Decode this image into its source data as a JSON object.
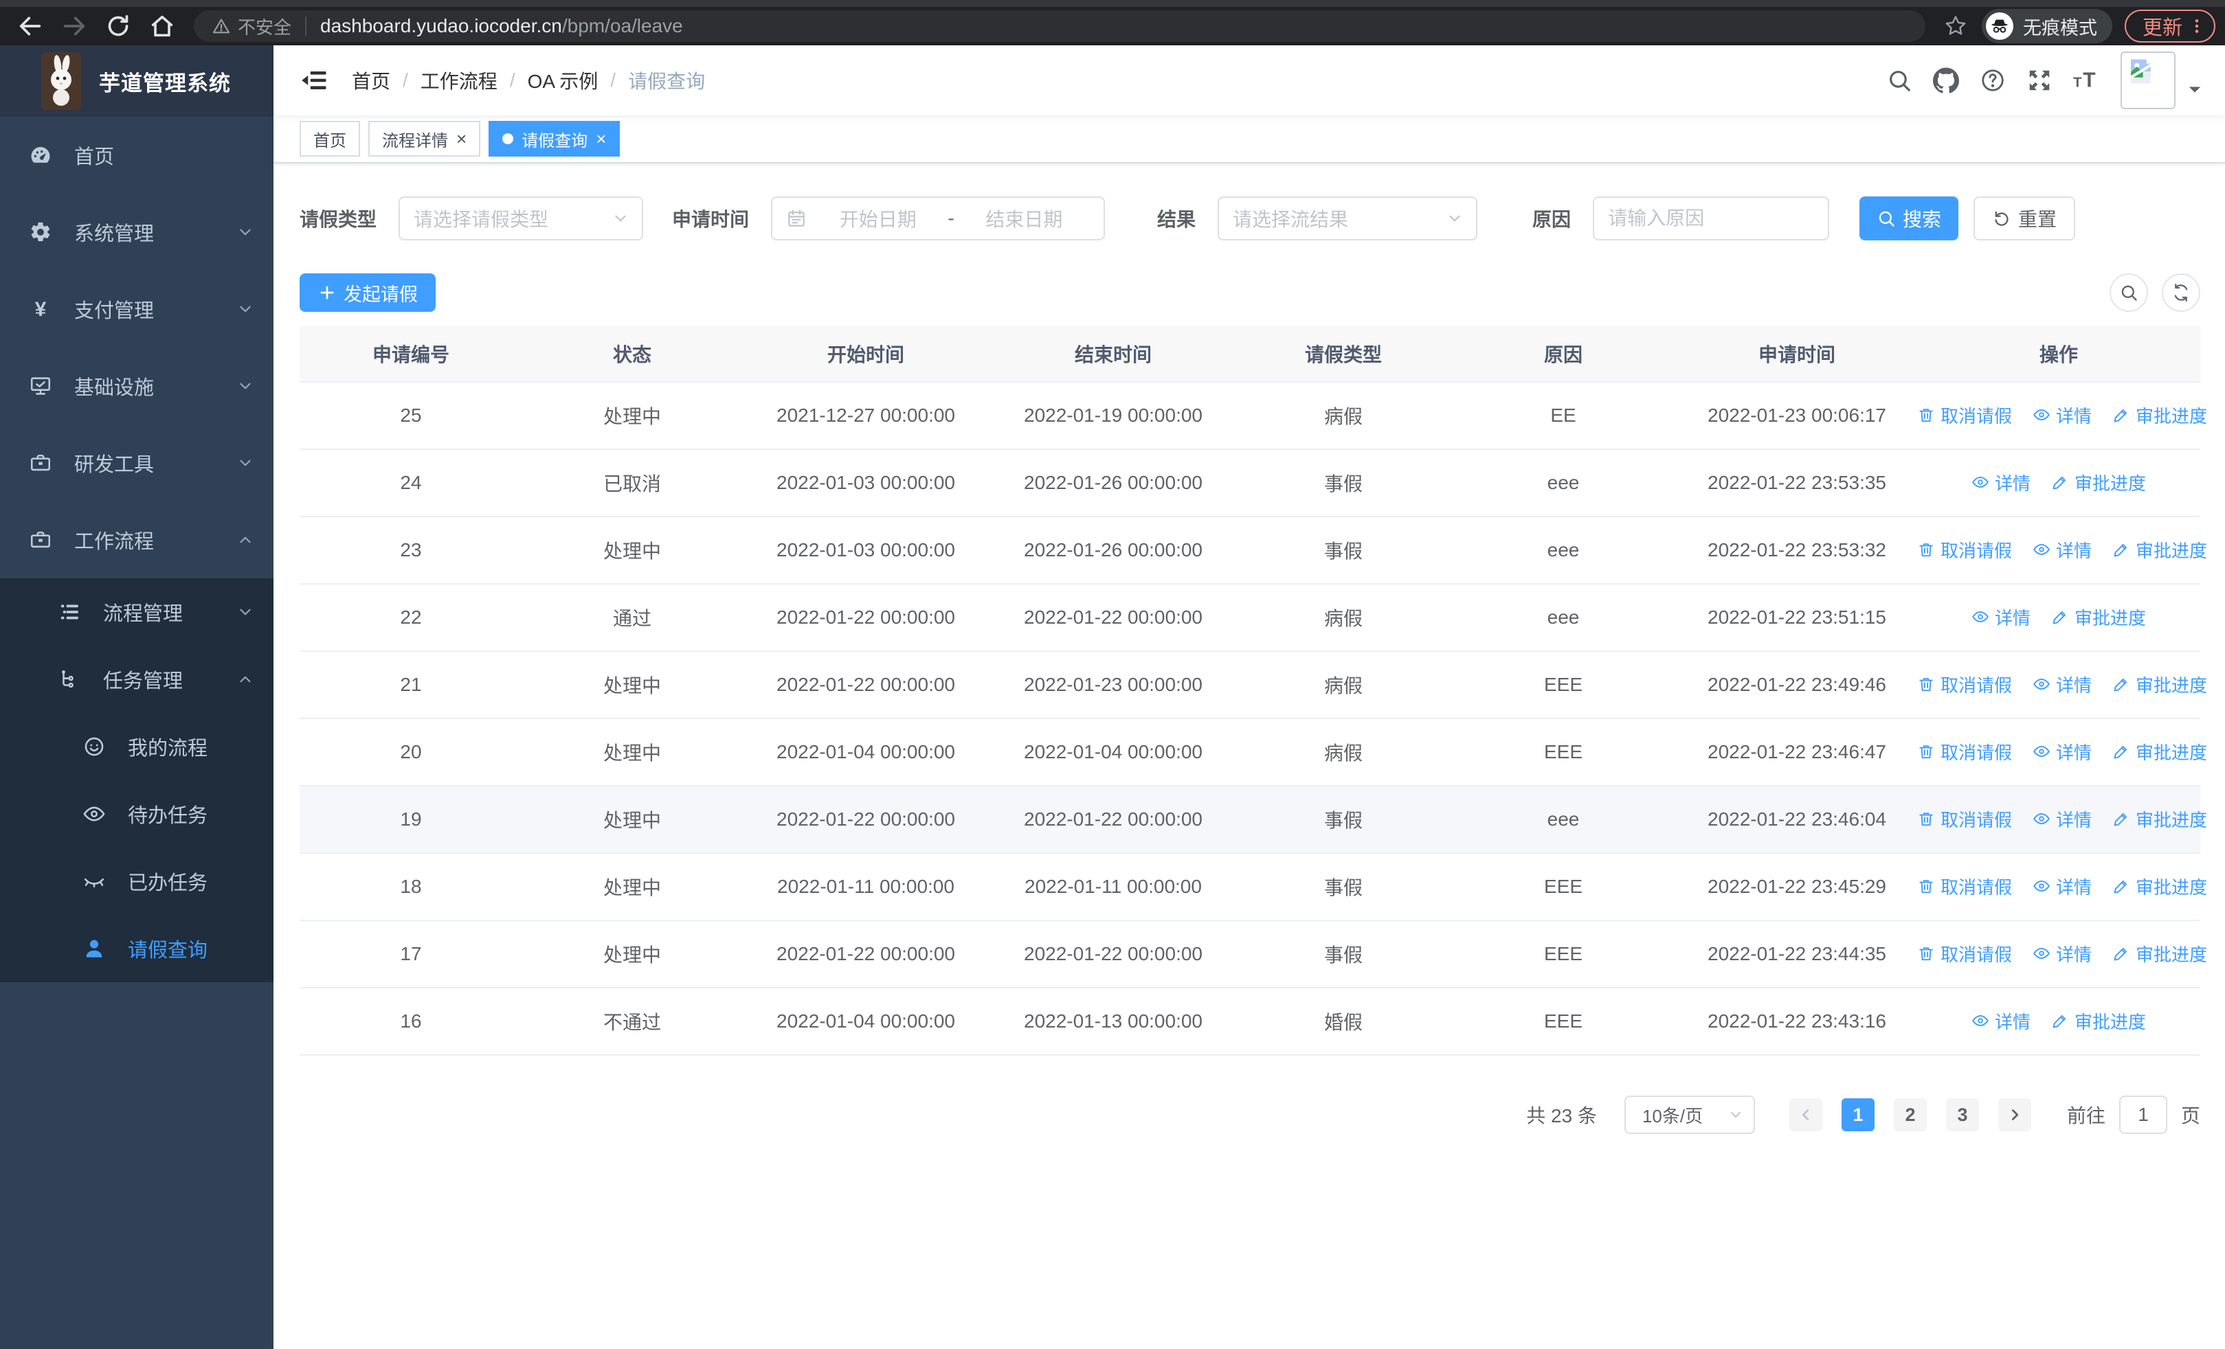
{
  "browser": {
    "insecure_label": "不安全",
    "url_host": "dashboard.yudao.iocoder.cn",
    "url_path": "/bpm/oa/leave",
    "incognito_label": "无痕模式",
    "update_label": "更新"
  },
  "app": {
    "title": "芋道管理系统"
  },
  "breadcrumb": {
    "separator": "/",
    "items": [
      {
        "label": "首页"
      },
      {
        "label": "工作流程"
      },
      {
        "label": "OA 示例"
      },
      {
        "label": "请假查询"
      }
    ]
  },
  "tabs": [
    {
      "label": "首页",
      "closable": false,
      "active": false
    },
    {
      "label": "流程详情",
      "closable": true,
      "active": false
    },
    {
      "label": "请假查询",
      "closable": true,
      "active": true
    }
  ],
  "sidebar": {
    "items": [
      {
        "id": "home",
        "label": "首页",
        "icon": "dashboard",
        "level": 1
      },
      {
        "id": "system",
        "label": "系统管理",
        "icon": "gear",
        "level": 1,
        "arrow": "down"
      },
      {
        "id": "payment",
        "label": "支付管理",
        "icon": "yen",
        "level": 1,
        "arrow": "down"
      },
      {
        "id": "infra",
        "label": "基础设施",
        "icon": "monitor",
        "level": 1,
        "arrow": "down"
      },
      {
        "id": "devtools",
        "label": "研发工具",
        "icon": "toolbox",
        "level": 1,
        "arrow": "down"
      },
      {
        "id": "workflow",
        "label": "工作流程",
        "icon": "toolbox",
        "level": 1,
        "arrow": "up"
      },
      {
        "id": "process-mgmt",
        "label": "流程管理",
        "icon": "list",
        "level": 2,
        "arrow": "down",
        "dark": true
      },
      {
        "id": "task-mgmt",
        "label": "任务管理",
        "icon": "flow",
        "level": 2,
        "arrow": "up",
        "dark": true
      },
      {
        "id": "my-process",
        "label": "我的流程",
        "icon": "face",
        "level": 3,
        "dark": true
      },
      {
        "id": "todo-task",
        "label": "待办任务",
        "icon": "eye",
        "level": 3,
        "dark": true
      },
      {
        "id": "done-task",
        "label": "已办任务",
        "icon": "eye-closed",
        "level": 3,
        "dark": true
      },
      {
        "id": "leave-query",
        "label": "请假查询",
        "icon": "user",
        "level": 3,
        "dark": true,
        "active": true
      }
    ]
  },
  "filters": {
    "leave_type_label": "请假类型",
    "leave_type_placeholder": "请选择请假类型",
    "apply_time_label": "申请时间",
    "start_placeholder": "开始日期",
    "range_separator": "-",
    "end_placeholder": "结束日期",
    "result_label": "结果",
    "result_placeholder": "请选择流结果",
    "reason_label": "原因",
    "reason_placeholder": "请输入原因",
    "search_label": "搜索",
    "reset_label": "重置"
  },
  "toolbar": {
    "create_label": "发起请假"
  },
  "table": {
    "columns": [
      "申请编号",
      "状态",
      "开始时间",
      "结束时间",
      "请假类型",
      "原因",
      "申请时间",
      "操作"
    ],
    "action_labels": {
      "cancel": "取消请假",
      "detail": "详情",
      "progress": "审批进度"
    },
    "action_icons": {
      "cancel": "trash",
      "detail": "eye",
      "progress": "pen"
    },
    "rows": [
      {
        "id": "25",
        "status": "处理中",
        "start": "2021-12-27 00:00:00",
        "end": "2022-01-19 00:00:00",
        "type": "病假",
        "reason": "EE",
        "applied": "2022-01-23 00:06:17",
        "actions": [
          "cancel",
          "detail",
          "progress"
        ]
      },
      {
        "id": "24",
        "status": "已取消",
        "start": "2022-01-03 00:00:00",
        "end": "2022-01-26 00:00:00",
        "type": "事假",
        "reason": "eee",
        "applied": "2022-01-22 23:53:35",
        "actions": [
          "detail",
          "progress"
        ]
      },
      {
        "id": "23",
        "status": "处理中",
        "start": "2022-01-03 00:00:00",
        "end": "2022-01-26 00:00:00",
        "type": "事假",
        "reason": "eee",
        "applied": "2022-01-22 23:53:32",
        "actions": [
          "cancel",
          "detail",
          "progress"
        ]
      },
      {
        "id": "22",
        "status": "通过",
        "start": "2022-01-22 00:00:00",
        "end": "2022-01-22 00:00:00",
        "type": "病假",
        "reason": "eee",
        "applied": "2022-01-22 23:51:15",
        "actions": [
          "detail",
          "progress"
        ]
      },
      {
        "id": "21",
        "status": "处理中",
        "start": "2022-01-22 00:00:00",
        "end": "2022-01-23 00:00:00",
        "type": "病假",
        "reason": "EEE",
        "applied": "2022-01-22 23:49:46",
        "actions": [
          "cancel",
          "detail",
          "progress"
        ]
      },
      {
        "id": "20",
        "status": "处理中",
        "start": "2022-01-04 00:00:00",
        "end": "2022-01-04 00:00:00",
        "type": "病假",
        "reason": "EEE",
        "applied": "2022-01-22 23:46:47",
        "actions": [
          "cancel",
          "detail",
          "progress"
        ]
      },
      {
        "id": "19",
        "status": "处理中",
        "start": "2022-01-22 00:00:00",
        "end": "2022-01-22 00:00:00",
        "type": "事假",
        "reason": "eee",
        "applied": "2022-01-22 23:46:04",
        "actions": [
          "cancel",
          "detail",
          "progress"
        ],
        "highlight": true
      },
      {
        "id": "18",
        "status": "处理中",
        "start": "2022-01-11 00:00:00",
        "end": "2022-01-11 00:00:00",
        "type": "事假",
        "reason": "EEE",
        "applied": "2022-01-22 23:45:29",
        "actions": [
          "cancel",
          "detail",
          "progress"
        ]
      },
      {
        "id": "17",
        "status": "处理中",
        "start": "2022-01-22 00:00:00",
        "end": "2022-01-22 00:00:00",
        "type": "事假",
        "reason": "EEE",
        "applied": "2022-01-22 23:44:35",
        "actions": [
          "cancel",
          "detail",
          "progress"
        ]
      },
      {
        "id": "16",
        "status": "不通过",
        "start": "2022-01-04 00:00:00",
        "end": "2022-01-13 00:00:00",
        "type": "婚假",
        "reason": "EEE",
        "applied": "2022-01-22 23:43:16",
        "actions": [
          "detail",
          "progress"
        ]
      }
    ]
  },
  "pagination": {
    "total": "共 23 条",
    "page_size": "10条/页",
    "pages": [
      "1",
      "2",
      "3"
    ],
    "current": "1",
    "goto_label": "前往",
    "goto_value": "1",
    "page_unit": "页"
  },
  "colors": {
    "accent": "#409eff",
    "sidebar_bg": "#304156",
    "submenu_bg": "#1f2d3d",
    "update_accent": "#f28b82"
  }
}
